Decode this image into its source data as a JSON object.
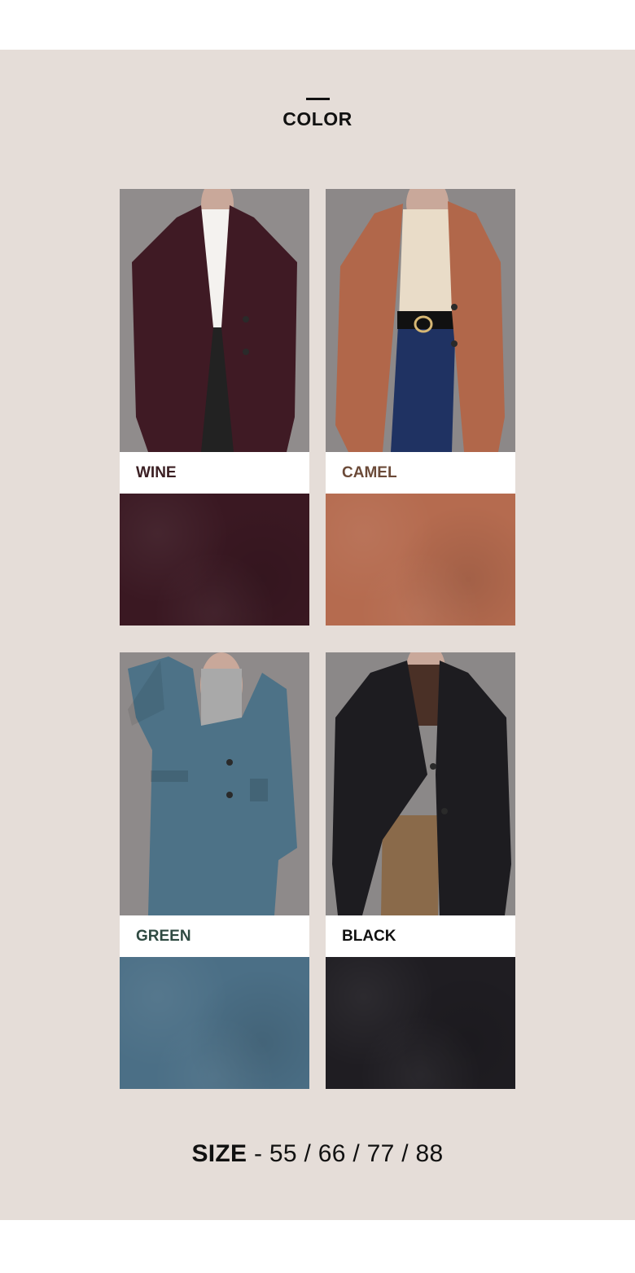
{
  "section": {
    "title": "COLOR"
  },
  "colors": [
    {
      "label": "WINE",
      "label_color": "#3a1e22",
      "coat_color": "#3f1a24",
      "inner_color": "#f4f2ef",
      "bottom_color": "#222222",
      "background_color": "#908c8c",
      "swatch_color": "#3a1822"
    },
    {
      "label": "CAMEL",
      "label_color": "#6b4a38",
      "coat_color": "#b1674a",
      "inner_color": "#e9dcc8",
      "bottom_color": "#1f3262",
      "background_color": "#8c8888",
      "swatch_color": "#b56b4f"
    },
    {
      "label": "GREEN",
      "label_color": "#2f4a42",
      "coat_color": "#4d7287",
      "inner_color": "#a9a9a9",
      "bottom_color": "#4d7287",
      "background_color": "#8e8a8a",
      "swatch_color": "#4b6f86"
    },
    {
      "label": "BLACK",
      "label_color": "#111111",
      "coat_color": "#1d1c20",
      "inner_color": "#4a3026",
      "bottom_color": "#8a6a4a",
      "background_color": "#8b8888",
      "swatch_color": "#1f1d22"
    }
  ],
  "size": {
    "label": "SIZE",
    "separator": " - ",
    "values": "55 / 66 / 77 / 88"
  }
}
